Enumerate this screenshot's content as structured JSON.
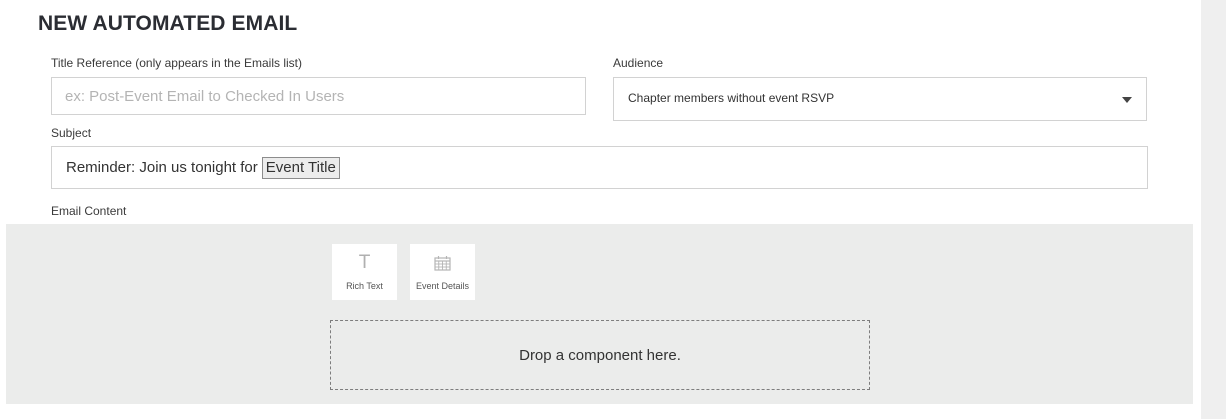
{
  "page": {
    "title": "NEW AUTOMATED EMAIL"
  },
  "form": {
    "title_reference": {
      "label": "Title Reference (only appears in the Emails list)",
      "placeholder": "ex: Post-Event Email to Checked In Users",
      "value": ""
    },
    "audience": {
      "label": "Audience",
      "selected": "Chapter members without event RSVP"
    },
    "subject": {
      "label": "Subject",
      "text": "Reminder: Join us tonight for",
      "token": "Event Title"
    },
    "email_content": {
      "label": "Email Content"
    }
  },
  "components": [
    {
      "label": "Rich Text",
      "icon": "text-icon"
    },
    {
      "label": "Event Details",
      "icon": "calendar-icon"
    }
  ],
  "drop_zone": {
    "text": "Drop a component here."
  }
}
